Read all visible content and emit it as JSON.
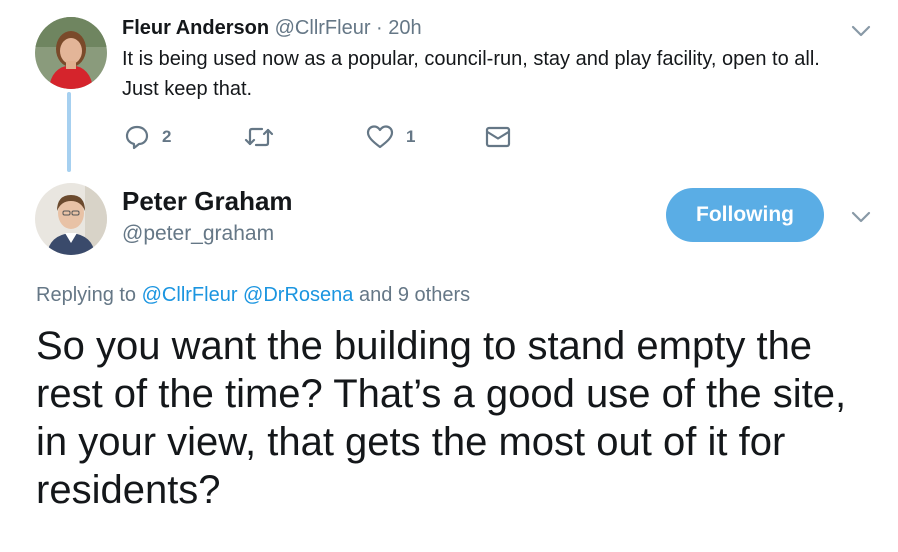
{
  "reply_tweet": {
    "author_name": "Fleur Anderson",
    "handle": "@CllrFleur",
    "separator": "·",
    "time": "20h",
    "text": "It is being used now as a popular, council-run, stay and play facility, open to all. Just keep that.",
    "actions": {
      "reply_icon": "reply-icon",
      "reply_count": "2",
      "retweet_icon": "retweet-icon",
      "like_icon": "heart-icon",
      "like_count": "1",
      "dm_icon": "envelope-icon"
    }
  },
  "main_tweet": {
    "author_name": "Peter Graham",
    "handle": "@peter_graham",
    "follow_label": "Following",
    "replying": {
      "prefix": "Replying to",
      "mention1": "@CllrFleur",
      "mention2": "@DrRosena",
      "suffix": "and 9 others"
    },
    "text": "So you want the building to stand empty the rest of the time? That’s a good use of the site, in your view, that gets the most out of it for residents?"
  },
  "colors": {
    "accent": "#1b95e0",
    "follow_button": "#5aade5",
    "thread_line": "#a6d0f0",
    "secondary_text": "#657786"
  }
}
